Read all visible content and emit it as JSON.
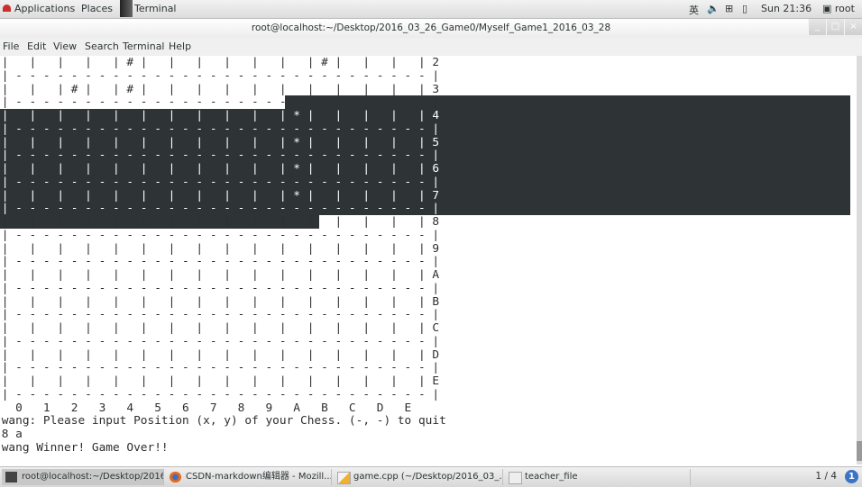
{
  "top_panel": {
    "applications_label": "Applications",
    "places_label": "Places",
    "active_app_label": "Terminal",
    "input_method": "英",
    "clock": "Sun 21:36",
    "user": "root"
  },
  "window": {
    "title": "root@localhost:~/Desktop/2016_03_26_Game0/Myself_Game1_2016_03_28",
    "minimize": "_",
    "maximize": "□",
    "close": "×"
  },
  "menubar": [
    "File",
    "Edit",
    "View",
    "Search",
    "Terminal",
    "Help"
  ],
  "terminal": {
    "lines": [
      " |   |   |   |   | # |   |   |   |   |   |   | # |   |   |   | 2",
      " | - - - - - - - - - - - - - - - - - - - - - - - - - - - - - - |",
      " |   |   | # |   | # |   |   |   |   |   |   |   |   |   |   | 3",
      " | - - - - - - - - - - - - - - - - - - - - - - - - - - - - - - |",
      " |   |   |   |   |   |   |   |   |   |   | * |   |   |   |   | 4",
      " | - - - - - - - - - - - - - - - - - - - - - - - - - - - - - - |",
      " |   |   |   |   |   |   |   |   |   |   | * |   |   |   |   | 5",
      " | - - - - - - - - - - - - - - - - - - - - - - - - - - - - - - |",
      " |   |   |   |   |   |   |   |   |   |   | * |   |   |   |   | 6",
      " | - - - - - - - - - - - - - - - - - - - - - - - - - - - - - - |",
      " |   |   |   |   |   |   |   |   |   |   | * |   |   |   |   | 7",
      " | - - - - - - - - - - - - - - - - - - - - - - - - - - - - - - |",
      " |   |   |   |   |   |   |   |   |   |   |   |   |   |   |   | 8",
      " | - - - - - - - - - - - - - - - - - - - - - - - - - - - - - - |",
      " |   |   |   |   |   |   |   |   |   |   |   |   |   |   |   | 9",
      " | - - - - - - - - - - - - - - - - - - - - - - - - - - - - - - |",
      " |   |   |   |   |   |   |   |   |   |   |   |   |   |   |   | A",
      " | - - - - - - - - - - - - - - - - - - - - - - - - - - - - - - |",
      " |   |   |   |   |   |   |   |   |   |   |   |   |   |   |   | B",
      " | - - - - - - - - - - - - - - - - - - - - - - - - - - - - - - |",
      " |   |   |   |   |   |   |   |   |   |   |   |   |   |   |   | C",
      " | - - - - - - - - - - - - - - - - - - - - - - - - - - - - - - |",
      " |   |   |   |   |   |   |   |   |   |   |   |   |   |   |   | D",
      " | - - - - - - - - - - - - - - - - - - - - - - - - - - - - - - |",
      " |   |   |   |   |   |   |   |   |   |   |   |   |   |   |   | E",
      " | - - - - - - - - - - - - - - - - - - - - - - - - - - - - - - |",
      "   0   1   2   3   4   5   6   7   8   9   A   B   C   D   E",
      " wang: Please input Position (x, y) of your Chess. (-, -) to quit",
      " 8 a",
      " wang Winner! Game Over!!"
    ]
  },
  "taskbar": {
    "tasks": [
      {
        "label": "root@localhost:~/Desktop/2016...",
        "icon": "terminal-icon",
        "active": true
      },
      {
        "label": "CSDN-markdown编辑器 - Mozill...",
        "icon": "firefox-icon",
        "active": false
      },
      {
        "label": "game.cpp (~/Desktop/2016_03_...",
        "icon": "text-editor-icon",
        "active": false
      },
      {
        "label": "teacher_file",
        "icon": "file-icon",
        "active": false
      }
    ],
    "workspace": "1 / 4",
    "notifications": "1"
  },
  "colors": {
    "selection_bg": "#2e3436",
    "selection_fg": "#ffffff",
    "terminal_bg": "#ffffff",
    "terminal_fg": "#2e2e2e"
  }
}
